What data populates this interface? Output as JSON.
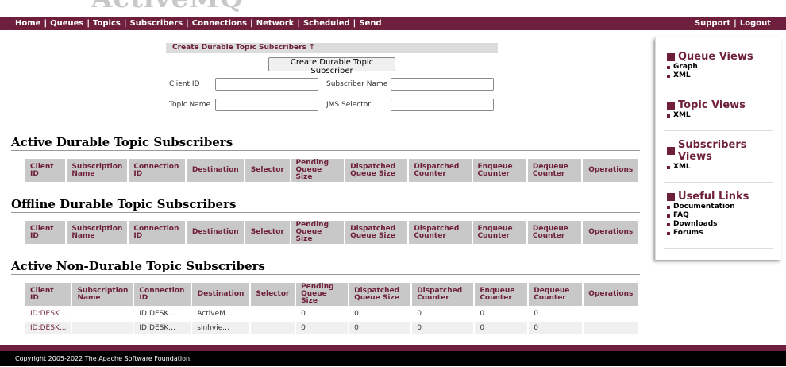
{
  "logo": "ActiveMQ",
  "nav": {
    "left": [
      "Home",
      "Queues",
      "Topics",
      "Subscribers",
      "Connections",
      "Network",
      "Scheduled",
      "Send"
    ],
    "right": [
      "Support",
      "Logout"
    ]
  },
  "form": {
    "title": "Create Durable Topic Subscribers ↑",
    "button": "Create Durable Topic Subscriber",
    "client_id_label": "Client ID",
    "subscriber_name_label": "Subscriber Name",
    "topic_name_label": "Topic Name",
    "jms_selector_label": "JMS Selector"
  },
  "sections": {
    "active_durable": "Active Durable Topic Subscribers",
    "offline_durable": "Offline Durable Topic Subscribers",
    "active_nondurable": "Active Non-Durable Topic Subscribers"
  },
  "columns": [
    [
      "Client",
      "ID"
    ],
    [
      "Subscription",
      "Name"
    ],
    [
      "Connection",
      "ID"
    ],
    [
      "Destination",
      ""
    ],
    [
      "Selector",
      ""
    ],
    [
      "Pending",
      "Queue Size"
    ],
    [
      "Dispatched",
      "Queue Size"
    ],
    [
      "Dispatched",
      "Counter"
    ],
    [
      "Enqueue",
      "Counter"
    ],
    [
      "Dequeue",
      "Counter"
    ],
    [
      "Operations",
      ""
    ]
  ],
  "nondurable_rows": [
    [
      "ID:DESK...",
      "",
      "ID:DESK...",
      "ActiveM...",
      "",
      "0",
      "0",
      "0",
      "0",
      "0",
      ""
    ],
    [
      "ID:DESK...",
      "",
      "ID:DESK...",
      "sinhvie...",
      "",
      "0",
      "0",
      "0",
      "0",
      "0",
      ""
    ]
  ],
  "sidebar": {
    "queue_views": {
      "title": "Queue Views",
      "items": [
        "Graph",
        "XML"
      ]
    },
    "topic_views": {
      "title": "Topic Views",
      "items": [
        "XML"
      ]
    },
    "subscribers_views": {
      "title_line1": "Subscribers",
      "title_line2": "Views",
      "items": [
        "XML"
      ]
    },
    "useful_links": {
      "title": "Useful Links",
      "items": [
        "Documentation",
        "FAQ",
        "Downloads",
        "Forums"
      ]
    }
  },
  "footer": "Copyright 2005-2022 The Apache Software Foundation.",
  "colors": {
    "brand": "#6e1f3c",
    "header_bg": "#c8c8c8"
  }
}
